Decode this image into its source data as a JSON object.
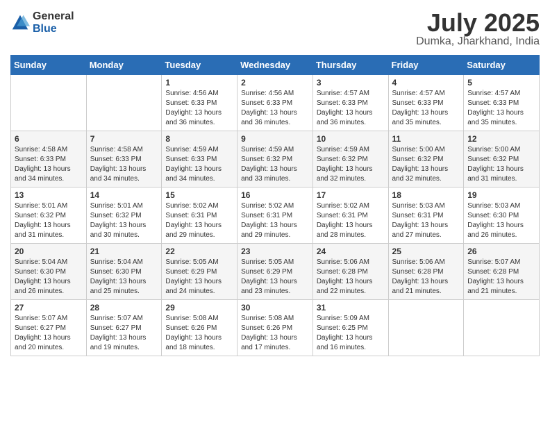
{
  "logo": {
    "general": "General",
    "blue": "Blue"
  },
  "title": "July 2025",
  "location": "Dumka, Jharkhand, India",
  "weekdays": [
    "Sunday",
    "Monday",
    "Tuesday",
    "Wednesday",
    "Thursday",
    "Friday",
    "Saturday"
  ],
  "weeks": [
    [
      {
        "day": "",
        "info": ""
      },
      {
        "day": "",
        "info": ""
      },
      {
        "day": "1",
        "info": "Sunrise: 4:56 AM\nSunset: 6:33 PM\nDaylight: 13 hours\nand 36 minutes."
      },
      {
        "day": "2",
        "info": "Sunrise: 4:56 AM\nSunset: 6:33 PM\nDaylight: 13 hours\nand 36 minutes."
      },
      {
        "day": "3",
        "info": "Sunrise: 4:57 AM\nSunset: 6:33 PM\nDaylight: 13 hours\nand 36 minutes."
      },
      {
        "day": "4",
        "info": "Sunrise: 4:57 AM\nSunset: 6:33 PM\nDaylight: 13 hours\nand 35 minutes."
      },
      {
        "day": "5",
        "info": "Sunrise: 4:57 AM\nSunset: 6:33 PM\nDaylight: 13 hours\nand 35 minutes."
      }
    ],
    [
      {
        "day": "6",
        "info": "Sunrise: 4:58 AM\nSunset: 6:33 PM\nDaylight: 13 hours\nand 34 minutes."
      },
      {
        "day": "7",
        "info": "Sunrise: 4:58 AM\nSunset: 6:33 PM\nDaylight: 13 hours\nand 34 minutes."
      },
      {
        "day": "8",
        "info": "Sunrise: 4:59 AM\nSunset: 6:33 PM\nDaylight: 13 hours\nand 34 minutes."
      },
      {
        "day": "9",
        "info": "Sunrise: 4:59 AM\nSunset: 6:32 PM\nDaylight: 13 hours\nand 33 minutes."
      },
      {
        "day": "10",
        "info": "Sunrise: 4:59 AM\nSunset: 6:32 PM\nDaylight: 13 hours\nand 32 minutes."
      },
      {
        "day": "11",
        "info": "Sunrise: 5:00 AM\nSunset: 6:32 PM\nDaylight: 13 hours\nand 32 minutes."
      },
      {
        "day": "12",
        "info": "Sunrise: 5:00 AM\nSunset: 6:32 PM\nDaylight: 13 hours\nand 31 minutes."
      }
    ],
    [
      {
        "day": "13",
        "info": "Sunrise: 5:01 AM\nSunset: 6:32 PM\nDaylight: 13 hours\nand 31 minutes."
      },
      {
        "day": "14",
        "info": "Sunrise: 5:01 AM\nSunset: 6:32 PM\nDaylight: 13 hours\nand 30 minutes."
      },
      {
        "day": "15",
        "info": "Sunrise: 5:02 AM\nSunset: 6:31 PM\nDaylight: 13 hours\nand 29 minutes."
      },
      {
        "day": "16",
        "info": "Sunrise: 5:02 AM\nSunset: 6:31 PM\nDaylight: 13 hours\nand 29 minutes."
      },
      {
        "day": "17",
        "info": "Sunrise: 5:02 AM\nSunset: 6:31 PM\nDaylight: 13 hours\nand 28 minutes."
      },
      {
        "day": "18",
        "info": "Sunrise: 5:03 AM\nSunset: 6:31 PM\nDaylight: 13 hours\nand 27 minutes."
      },
      {
        "day": "19",
        "info": "Sunrise: 5:03 AM\nSunset: 6:30 PM\nDaylight: 13 hours\nand 26 minutes."
      }
    ],
    [
      {
        "day": "20",
        "info": "Sunrise: 5:04 AM\nSunset: 6:30 PM\nDaylight: 13 hours\nand 26 minutes."
      },
      {
        "day": "21",
        "info": "Sunrise: 5:04 AM\nSunset: 6:30 PM\nDaylight: 13 hours\nand 25 minutes."
      },
      {
        "day": "22",
        "info": "Sunrise: 5:05 AM\nSunset: 6:29 PM\nDaylight: 13 hours\nand 24 minutes."
      },
      {
        "day": "23",
        "info": "Sunrise: 5:05 AM\nSunset: 6:29 PM\nDaylight: 13 hours\nand 23 minutes."
      },
      {
        "day": "24",
        "info": "Sunrise: 5:06 AM\nSunset: 6:28 PM\nDaylight: 13 hours\nand 22 minutes."
      },
      {
        "day": "25",
        "info": "Sunrise: 5:06 AM\nSunset: 6:28 PM\nDaylight: 13 hours\nand 21 minutes."
      },
      {
        "day": "26",
        "info": "Sunrise: 5:07 AM\nSunset: 6:28 PM\nDaylight: 13 hours\nand 21 minutes."
      }
    ],
    [
      {
        "day": "27",
        "info": "Sunrise: 5:07 AM\nSunset: 6:27 PM\nDaylight: 13 hours\nand 20 minutes."
      },
      {
        "day": "28",
        "info": "Sunrise: 5:07 AM\nSunset: 6:27 PM\nDaylight: 13 hours\nand 19 minutes."
      },
      {
        "day": "29",
        "info": "Sunrise: 5:08 AM\nSunset: 6:26 PM\nDaylight: 13 hours\nand 18 minutes."
      },
      {
        "day": "30",
        "info": "Sunrise: 5:08 AM\nSunset: 6:26 PM\nDaylight: 13 hours\nand 17 minutes."
      },
      {
        "day": "31",
        "info": "Sunrise: 5:09 AM\nSunset: 6:25 PM\nDaylight: 13 hours\nand 16 minutes."
      },
      {
        "day": "",
        "info": ""
      },
      {
        "day": "",
        "info": ""
      }
    ]
  ]
}
